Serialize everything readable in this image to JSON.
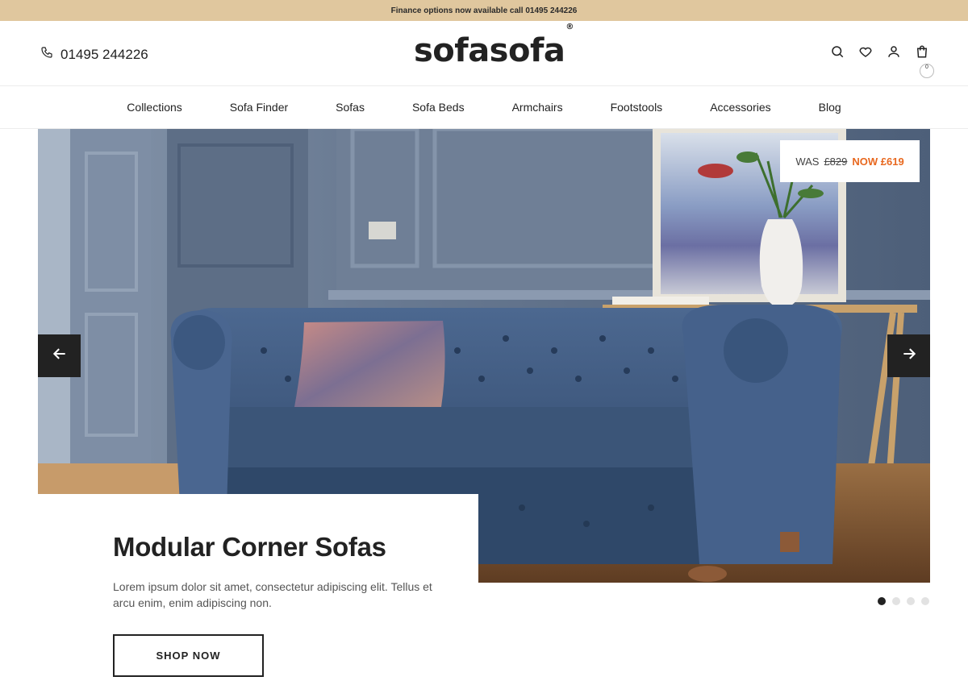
{
  "announcement": {
    "text": "Finance options now available call 01495 244226"
  },
  "header": {
    "phone": "01495 244226",
    "logo": "sofasofa",
    "logo_mark": "®",
    "cart_count": "0",
    "icons": [
      "phone-icon",
      "search-icon",
      "heart-icon",
      "user-icon",
      "bag-icon"
    ]
  },
  "nav": {
    "items": [
      {
        "label": "Collections"
      },
      {
        "label": "Sofa Finder"
      },
      {
        "label": "Sofas"
      },
      {
        "label": "Sofa Beds"
      },
      {
        "label": "Armchairs"
      },
      {
        "label": "Footstools"
      },
      {
        "label": "Accessories"
      },
      {
        "label": "Blog"
      }
    ]
  },
  "hero": {
    "price_was_label": "WAS",
    "price_was": "£829",
    "price_now": "NOW £619",
    "title": "Modular Corner Sofas",
    "description": "Lorem ipsum dolor sit amet, consectetur adipiscing elit. Tellus et arcu enim, enim adipiscing non.",
    "button": "SHOP NOW",
    "slides_total": 4,
    "slide_active": 1
  },
  "colors": {
    "announcement_bg": "#e0c79e",
    "accent_price": "#e8681f",
    "dark": "#222222",
    "sofa": "#3a5478",
    "wall": "#67788f"
  }
}
